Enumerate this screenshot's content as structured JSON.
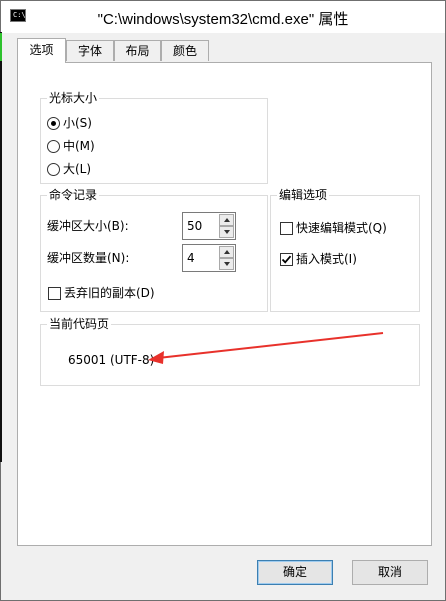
{
  "window": {
    "title": "\"C:\\windows\\system32\\cmd.exe\" 属性",
    "icon_text": "C:\\"
  },
  "tabs": [
    {
      "label": "选项",
      "active": true
    },
    {
      "label": "字体",
      "active": false
    },
    {
      "label": "布局",
      "active": false
    },
    {
      "label": "颜色",
      "active": false
    }
  ],
  "cursor_size": {
    "title": "光标大小",
    "options": [
      {
        "label": "小(S)",
        "selected": true
      },
      {
        "label": "中(M)",
        "selected": false
      },
      {
        "label": "大(L)",
        "selected": false
      }
    ]
  },
  "command_history": {
    "title": "命令记录",
    "buffer_size_label": "缓冲区大小(B):",
    "buffer_size_value": "50",
    "buffer_count_label": "缓冲区数量(N):",
    "buffer_count_value": "4",
    "discard_dup_label": "丢弃旧的副本(D)",
    "discard_dup_checked": false
  },
  "edit_options": {
    "title": "编辑选项",
    "quick_edit_label": "快速编辑模式(Q)",
    "quick_edit_checked": false,
    "insert_mode_label": "插入模式(I)",
    "insert_mode_checked": true
  },
  "codepage": {
    "title": "当前代码页",
    "value": "65001 (UTF-8)"
  },
  "annotation": {
    "arrow_color": "#e8312b"
  },
  "buttons": {
    "ok": "确定",
    "cancel": "取消"
  }
}
